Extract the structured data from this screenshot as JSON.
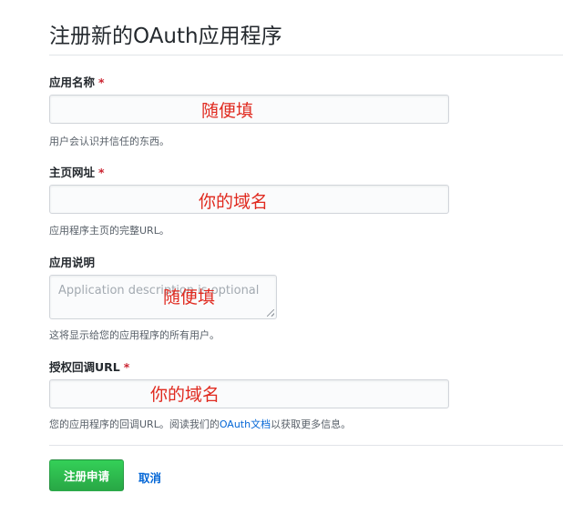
{
  "page": {
    "title": "注册新的OAuth应用程序"
  },
  "fields": {
    "app_name": {
      "label": "应用名称",
      "required_mark": "*",
      "annotation": "随便填",
      "note": "用户会认识并信任的东西。"
    },
    "homepage_url": {
      "label": "主页网址",
      "required_mark": "*",
      "annotation": "你的域名",
      "note": "应用程序主页的完整URL。"
    },
    "description": {
      "label": "应用说明",
      "placeholder": "Application description is optional",
      "annotation": "随便填",
      "note": "这将显示给您的应用程序的所有用户。"
    },
    "callback_url": {
      "label": "授权回调URL",
      "required_mark": "*",
      "annotation": "你的域名",
      "note_before": "您的应用程序的回调URL。阅读我们的",
      "note_link": "OAuth文档",
      "note_after": "以获取更多信息。"
    }
  },
  "actions": {
    "register_label": "注册申请",
    "cancel_label": "取消"
  },
  "colors": {
    "primary_button": "#28a745",
    "link": "#0366d6",
    "required": "#cb2431",
    "annotation": "#e02a1f"
  }
}
